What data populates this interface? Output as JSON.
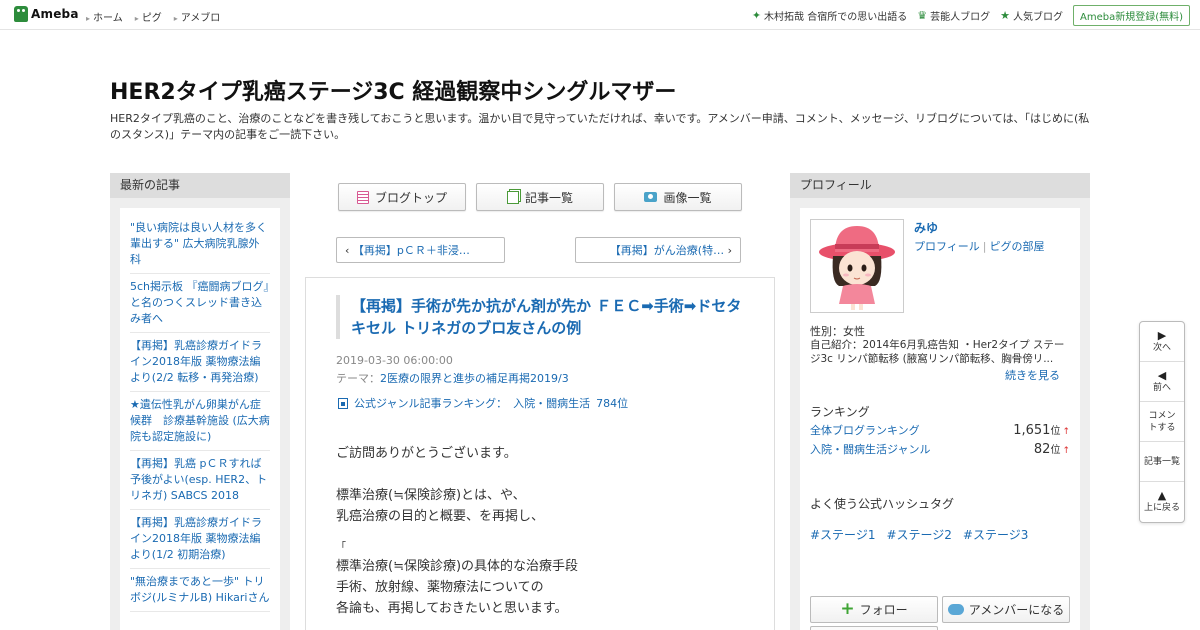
{
  "topbar": {
    "logo_text": "Ameba",
    "nav": [
      "ホーム",
      "ピグ",
      "アメブロ"
    ],
    "right_items": [
      {
        "icon": "sparkle-icon",
        "glyph": "✦",
        "label": "木村拓哉 合宿所での思い出語る"
      },
      {
        "icon": "crown-icon",
        "glyph": "♛",
        "label": "芸能人ブログ"
      },
      {
        "icon": "star-icon",
        "glyph": "★",
        "label": "人気ブログ"
      }
    ],
    "signup_label": "Ameba新規登録(無料)"
  },
  "header": {
    "title": "HER2タイプ乳癌ステージ3C 経過観察中シングルマザー",
    "description": "HER2タイプ乳癌のこと、治療のことなどを書き残しておこうと思います。温かい目で見守っていただければ、幸いです。アメンバー申請、コメント、メッセージ、リブログについては、「はじめに(私のスタンス)」テーマ内の記事をご一読下さい。"
  },
  "left": {
    "heading": "最新の記事",
    "recent": [
      "\"良い病院は良い人材を多く輩出する\" 広大病院乳腺外科",
      "5ch掲示板 『癌闘病ブログ』と名のつくスレッド書き込み者へ",
      "【再掲】乳癌診療ガイドライン2018年版 薬物療法編より(2/2 転移・再発治療)",
      "★遺伝性乳がん卵巣がん症候群　診療基幹施設 (広大病院も認定施設に)",
      "【再掲】乳癌 pＣＲすれば予後がよい(esp. HER2、トリネガ) SABCS 2018",
      "【再掲】乳癌診療ガイドライン2018年版 薬物療法編より(1/2 初期治療)",
      "\"無治療まであと一歩\" トリボジ(ルミナルB) Hikariさん"
    ]
  },
  "center": {
    "nav": [
      {
        "label": "ブログトップ",
        "icon": "blog-top-icon"
      },
      {
        "label": "記事一覧",
        "icon": "article-list-icon"
      },
      {
        "label": "画像一覧",
        "icon": "image-list-icon"
      }
    ],
    "prev_label": "【再掲】pＣＲ＋非浸…",
    "next_label": "【再掲】がん治療(特…",
    "article": {
      "title": "【再掲】手術が先か抗がん剤が先か ＦＥＣ➡手術➡ドセタキセル トリネガのブロ友さんの例",
      "date": "2019-03-30 06:00:00",
      "theme_prefix": "テーマ：",
      "theme": "2医療の限界と進歩の補足再掲2019/3",
      "ranking_label": "公式ジャンル記事ランキング：",
      "ranking_genre": "入院・闘病生活",
      "ranking_value": "784位",
      "body": [
        "ご訪問ありがとうございます。",
        "標準治療(≒保険診療)とは、や、",
        "乳癌治療の目的と概要、を再掲し、",
        "「",
        "標準治療(≒保険診療)の具体的な治療手段",
        "手術、放射線、薬物療法についての",
        "各論も、再掲しておきたいと思います。"
      ]
    }
  },
  "right": {
    "heading": "プロフィール",
    "name": "みゆ",
    "link_profile": "プロフィール",
    "link_pig": "ピグの部屋",
    "gender": "性別：女性",
    "intro": "自己紹介：2014年6月乳癌告知 ・Her2タイプ ステージ3c リンパ節転移 (腋窩リンパ節転移、胸骨傍リ...",
    "more": "続きを見る",
    "ranking_head": "ランキング",
    "rankings": [
      {
        "label": "全体ブログランキング",
        "value": "1,651",
        "unit": "位",
        "arrow": "↑"
      },
      {
        "label": "入院・闘病生活ジャンル",
        "value": "82",
        "unit": "位",
        "arrow": "↑"
      }
    ],
    "hashtag_head": "よく使う公式ハッシュタグ",
    "hashtags": [
      "#ステージ1",
      "#ステージ2",
      "#ステージ3"
    ],
    "follow_label": "フォロー",
    "amember_label": "アメンバーになる"
  },
  "side_nav": [
    {
      "glyph": "▶",
      "label": "次へ",
      "icon": "next-icon"
    },
    {
      "glyph": "◀",
      "label": "前へ",
      "icon": "prev-icon"
    },
    {
      "glyph": "",
      "label": "コメントする",
      "icon": ""
    },
    {
      "glyph": "",
      "label": "記事一覧",
      "icon": ""
    },
    {
      "glyph": "▲",
      "label": "上に戻る",
      "icon": "up-icon"
    }
  ],
  "colors": {
    "accent_green": "#2d8c3c",
    "link_blue": "#1a6ab2"
  }
}
